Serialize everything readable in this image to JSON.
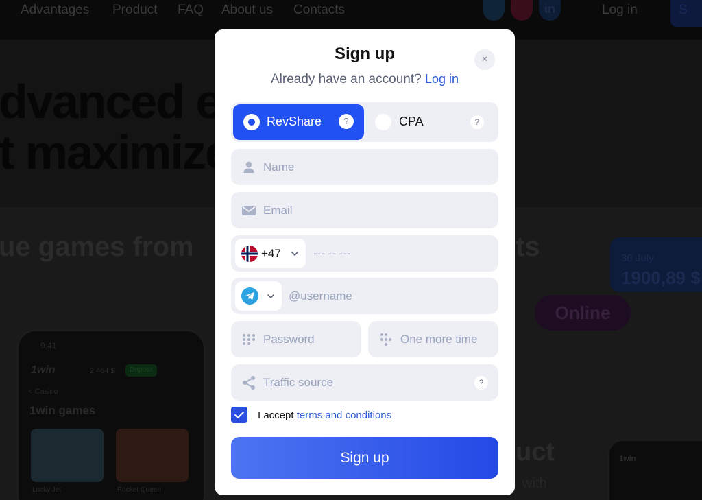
{
  "background": {
    "nav": [
      "Advantages",
      "Product",
      "FAQ",
      "About us",
      "Contacts"
    ],
    "social": [
      "telegram-icon",
      "instagram-icon",
      "linkedin-icon"
    ],
    "linkedin_glyph": "in",
    "login": "Log in",
    "signup_glyph": "S",
    "hero_line1": "dvanced e",
    "hero_line2": "t maximize",
    "games_heading": "ue games from",
    "ts_heading": "ts",
    "stat_date": "30 July",
    "stat_amount": "1900,89 $",
    "online_badge": "Online",
    "product_heading": "uct",
    "with_text": "with",
    "phone": {
      "time": "9:41",
      "logo": "1win",
      "amount": "2 464 $",
      "deposit": "Deposit",
      "casino": "< Casino",
      "games_title": "1win games",
      "game1": "Lucky Jet",
      "game2": "Rocket Queen"
    },
    "phone2_logo": "1win"
  },
  "modal": {
    "title": "Sign up",
    "close_glyph": "×",
    "subtitle": "Already have an account?",
    "login_link": "Log in",
    "mode_options": [
      {
        "label": "RevShare",
        "selected": true
      },
      {
        "label": "CPA",
        "selected": false
      }
    ],
    "help_glyph": "?",
    "name_placeholder": "Name",
    "email_placeholder": "Email",
    "phone": {
      "country": "Norway",
      "dial_code": "+47",
      "placeholder": "--- -- ---"
    },
    "messenger": {
      "type": "Telegram",
      "placeholder": "@username"
    },
    "password_placeholder": "Password",
    "password_confirm_placeholder": "One more time",
    "traffic_placeholder": "Traffic source",
    "accept": {
      "checked": true,
      "text": "I accept ",
      "link": "terms and conditions"
    },
    "submit_label": "Sign up"
  },
  "colors": {
    "accent": "#2151f2",
    "link": "#2f5bd8",
    "field_bg": "#edeff4",
    "placeholder": "#9aa3bd"
  }
}
